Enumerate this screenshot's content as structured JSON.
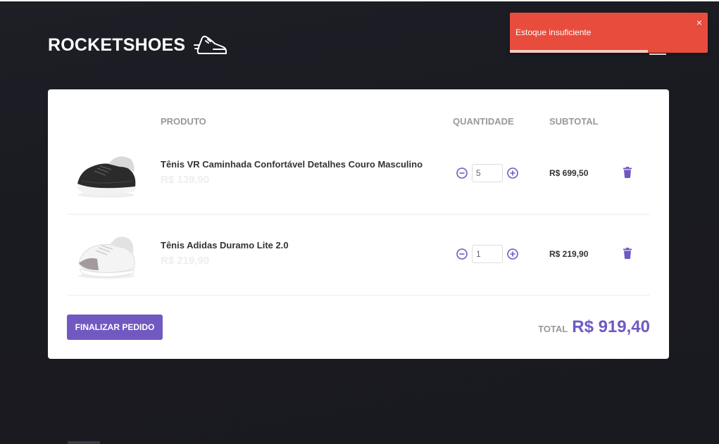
{
  "header": {
    "logo_text": "ROCKETSHOES",
    "logo_icon": "running-shoe-icon"
  },
  "toast": {
    "message": "Estoque insuficiente",
    "close_label": "×",
    "color": "#e74c3c"
  },
  "table": {
    "headers": {
      "product": "PRODUTO",
      "quantity": "QUANTIDADE",
      "subtotal": "SUBTOTAL"
    },
    "items": [
      {
        "title": "Tênis VR Caminhada Confortável Detalhes Couro Masculino",
        "price": "R$ 139,90",
        "quantity": "5",
        "subtotal": "R$ 699,50",
        "image": "black-sneaker-image"
      },
      {
        "title": "Tênis Adidas Duramo Lite 2.0",
        "price": "R$ 219,90",
        "quantity": "1",
        "subtotal": "R$ 219,90",
        "image": "white-sneaker-image"
      }
    ]
  },
  "footer": {
    "finish_label": "FINALIZAR PEDIDO",
    "total_label": "TOTAL",
    "total_value": "R$ 919,40"
  },
  "colors": {
    "accent": "#7159c1",
    "background": "#191920"
  }
}
